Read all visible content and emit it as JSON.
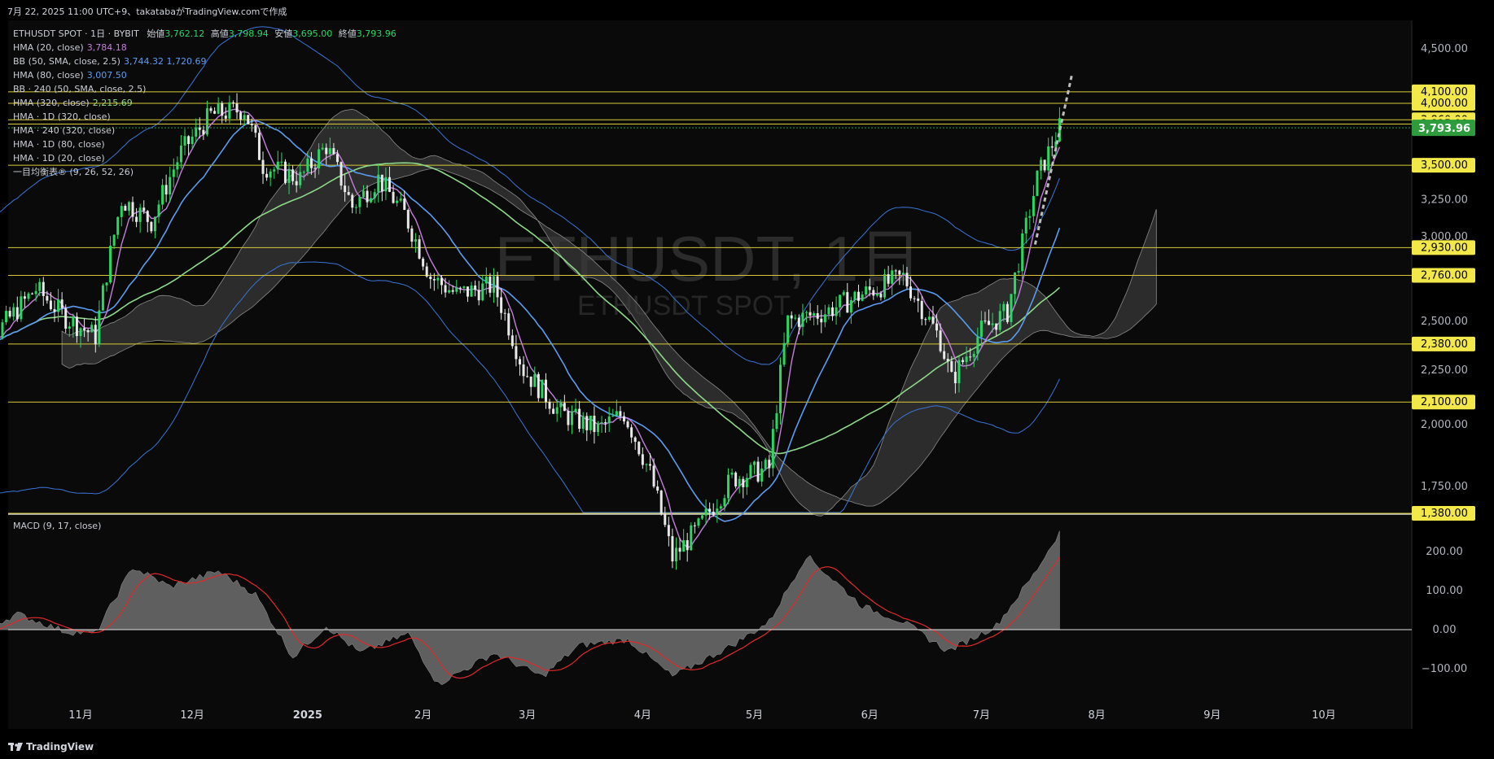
{
  "header": {
    "timestamp": "7月 22, 2025 11:00 UTC+9、takatabaがTradingView.comで作成"
  },
  "legend": {
    "symbol": "ETHUSDT SPOT · 1日 · BYBIT",
    "ohlc": [
      {
        "label": "始値",
        "value": "3,762.12"
      },
      {
        "label": "高値",
        "value": "3,798.94"
      },
      {
        "label": "安値",
        "value": "3,695.00"
      },
      {
        "label": "終値",
        "value": "3,793.96"
      }
    ],
    "indicators": [
      {
        "name": "HMA (20, close)",
        "value": "3,784.18",
        "color": "#c77ddb"
      },
      {
        "name": "BB (50, SMA, close, 2.5)",
        "value": "3,744.32  1,720.69",
        "color": "#5b9cf0"
      },
      {
        "name": "HMA (80, close)",
        "value": "3,007.50",
        "color": "#5b9cf0"
      },
      {
        "name": "BB · 240 (50, SMA, close, 2.5)",
        "value": "",
        "color": "#c9ccd4"
      },
      {
        "name": "HMA (320, close)",
        "value": "2,215.69",
        "color": "#8ed98a"
      },
      {
        "name": "HMA · 1D (320, close)",
        "value": "",
        "color": "#c9ccd4"
      },
      {
        "name": "HMA · 240 (320, close)",
        "value": "",
        "color": "#c9ccd4"
      },
      {
        "name": "HMA · 1D (80, close)",
        "value": "",
        "color": "#c9ccd4"
      },
      {
        "name": "HMA · 1D (20, close)",
        "value": "",
        "color": "#c9ccd4"
      },
      {
        "name": "一目均衡表® (9, 26, 52, 26)",
        "value": "",
        "color": "#c9ccd4"
      }
    ]
  },
  "watermark": {
    "main": "ETHUSDT, 1日",
    "sub": "ETHUSDT SPOT"
  },
  "macd_label": "MACD (9, 17, close)",
  "brand": "TradingView",
  "colors": {
    "bg": "#000000",
    "up": "#26d962",
    "down": "#e8e8e8",
    "level": "#d9c93a",
    "price_tag": "#2e9b3c",
    "level_tag": "#f2e84a",
    "hma20": "#c77ddb",
    "hma80": "#5b9cf0",
    "hma320": "#8ed98a",
    "bb": "#3a75d6",
    "macd_hist": "#6e6e6e",
    "macd_signal": "#e02a2a"
  },
  "chart_data": {
    "type": "candlestick",
    "price_axis": {
      "ticks": [
        1750,
        2000,
        2250,
        2500,
        3000,
        3250,
        4500
      ],
      "tick_labels": [
        "1,750.00",
        "2,000.00",
        "2,250.00",
        "2,500.00",
        "3,000.00",
        "3,250.00",
        "4,500.00"
      ]
    },
    "horizontal_levels": [
      4100,
      4000,
      3860,
      3825,
      3500,
      2930,
      2760,
      2380,
      2100,
      1380
    ],
    "level_labels": [
      "4,100.00",
      "4,000.00",
      "3,860.00",
      "3,825.00",
      "3,500.00",
      "2,930.00",
      "2,760.00",
      "2,380.00",
      "2,100.00",
      "1,380.00"
    ],
    "last_price": 3793.96,
    "last_price_label": "3,793.96",
    "time_axis": {
      "labels": [
        "11月",
        "12月",
        "2025",
        "2月",
        "3月",
        "4月",
        "5月",
        "6月",
        "7月",
        "8月",
        "9月",
        "10月"
      ],
      "label_dates": [
        "2024-11-01",
        "2024-12-01",
        "2025-01-01",
        "2025-02-01",
        "2025-03-01",
        "2025-04-01",
        "2025-05-01",
        "2025-06-01",
        "2025-07-01",
        "2025-08-01",
        "2025-09-01",
        "2025-10-01"
      ]
    },
    "close_path": [
      [
        "2024-10-01",
        2400
      ],
      [
        "2024-10-10",
        2450
      ],
      [
        "2024-10-20",
        2680
      ],
      [
        "2024-10-28",
        2520
      ],
      [
        "2024-11-05",
        2420
      ],
      [
        "2024-11-12",
        3250
      ],
      [
        "2024-11-20",
        3100
      ],
      [
        "2024-11-28",
        3600
      ],
      [
        "2024-12-06",
        3900
      ],
      [
        "2024-12-15",
        3950
      ],
      [
        "2024-12-20",
        3500
      ],
      [
        "2024-12-30",
        3400
      ],
      [
        "2025-01-06",
        3650
      ],
      [
        "2025-01-13",
        3200
      ],
      [
        "2025-01-20",
        3400
      ],
      [
        "2025-01-27",
        3150
      ],
      [
        "2025-02-03",
        2750
      ],
      [
        "2025-02-10",
        2650
      ],
      [
        "2025-02-20",
        2700
      ],
      [
        "2025-02-28",
        2250
      ],
      [
        "2025-03-10",
        2050
      ],
      [
        "2025-03-20",
        1980
      ],
      [
        "2025-03-27",
        2050
      ],
      [
        "2025-04-03",
        1800
      ],
      [
        "2025-04-09",
        1500
      ],
      [
        "2025-04-16",
        1600
      ],
      [
        "2025-04-25",
        1780
      ],
      [
        "2025-05-05",
        1820
      ],
      [
        "2025-05-10",
        2500
      ],
      [
        "2025-05-20",
        2550
      ],
      [
        "2025-05-30",
        2650
      ],
      [
        "2025-06-10",
        2750
      ],
      [
        "2025-06-20",
        2400
      ],
      [
        "2025-06-23",
        2200
      ],
      [
        "2025-07-01",
        2450
      ],
      [
        "2025-07-08",
        2550
      ],
      [
        "2025-07-12",
        2950
      ],
      [
        "2025-07-16",
        3400
      ],
      [
        "2025-07-22",
        3793.96
      ]
    ],
    "macd": {
      "axis_ticks": [
        200,
        100,
        0,
        -100
      ],
      "axis_labels": [
        "200.00",
        "100.00",
        "0.00",
        "−100.00"
      ],
      "values": [
        [
          "2024-10-01",
          -20
        ],
        [
          "2024-10-15",
          40
        ],
        [
          "2024-10-28",
          -5
        ],
        [
          "2024-11-05",
          -10
        ],
        [
          "2024-11-15",
          160
        ],
        [
          "2024-11-25",
          110
        ],
        [
          "2024-12-08",
          150
        ],
        [
          "2024-12-18",
          90
        ],
        [
          "2024-12-28",
          -70
        ],
        [
          "2025-01-06",
          10
        ],
        [
          "2025-01-15",
          -60
        ],
        [
          "2025-01-28",
          -10
        ],
        [
          "2025-02-05",
          -140
        ],
        [
          "2025-02-20",
          -60
        ],
        [
          "2025-03-05",
          -120
        ],
        [
          "2025-03-15",
          -40
        ],
        [
          "2025-03-28",
          -25
        ],
        [
          "2025-04-09",
          -120
        ],
        [
          "2025-04-25",
          -40
        ],
        [
          "2025-05-05",
          20
        ],
        [
          "2025-05-15",
          190
        ],
        [
          "2025-05-30",
          60
        ],
        [
          "2025-06-10",
          20
        ],
        [
          "2025-06-22",
          -55
        ],
        [
          "2025-07-05",
          10
        ],
        [
          "2025-07-15",
          140
        ],
        [
          "2025-07-22",
          250
        ]
      ]
    }
  }
}
